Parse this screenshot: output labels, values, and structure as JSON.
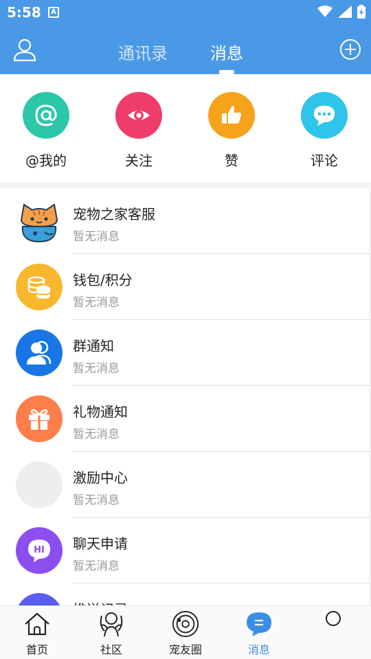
{
  "status_bar": {
    "time": "5:58",
    "notification_icon": "A"
  },
  "header": {
    "tabs": [
      {
        "label": "通讯录",
        "active": false
      },
      {
        "label": "消息",
        "active": true
      }
    ],
    "user_icon": "user-icon",
    "add_icon": "plus-circle-icon"
  },
  "quick_actions": [
    {
      "label": "@我的",
      "icon": "at-icon",
      "color": "#2cc7a8"
    },
    {
      "label": "关注",
      "icon": "eye-icon",
      "color": "#ee3d6b"
    },
    {
      "label": "赞",
      "icon": "thumbs-up-icon",
      "color": "#f7a21b"
    },
    {
      "label": "评论",
      "icon": "chat-bubble-icon",
      "color": "#2fc4ea"
    }
  ],
  "messages": [
    {
      "title": "宠物之家客服",
      "subtitle": "暂无消息",
      "icon": "cat-mascot-icon"
    },
    {
      "title": "钱包/积分",
      "subtitle": "暂无消息",
      "icon": "coins-icon",
      "color": "#f9b72e"
    },
    {
      "title": "群通知",
      "subtitle": "暂无消息",
      "icon": "group-icon",
      "color": "#1976e6"
    },
    {
      "title": "礼物通知",
      "subtitle": "暂无消息",
      "icon": "gift-icon",
      "color": "#fd7e4b"
    },
    {
      "title": "激励中心",
      "subtitle": "暂无消息",
      "icon": "placeholder-avatar",
      "color": "#eeeeee"
    },
    {
      "title": "聊天申请",
      "subtitle": "暂无消息",
      "icon": "hi-bubble-icon",
      "color": "#8b4ff0",
      "badge_text": "HI"
    },
    {
      "title": "推送记录",
      "subtitle": "",
      "icon": "push-icon",
      "color": "#5b5cf0"
    }
  ],
  "bottom_nav": [
    {
      "label": "首页",
      "icon": "home-icon",
      "active": false
    },
    {
      "label": "社区",
      "icon": "community-icon",
      "active": false
    },
    {
      "label": "宠友圈",
      "icon": "planet-icon",
      "active": false
    },
    {
      "label": "消息",
      "icon": "message-icon",
      "active": true
    },
    {
      "label": "",
      "icon": "circle-icon",
      "active": false
    }
  ],
  "colors": {
    "primary": "#4a99e6",
    "active_tab": "#3a8ee6"
  }
}
